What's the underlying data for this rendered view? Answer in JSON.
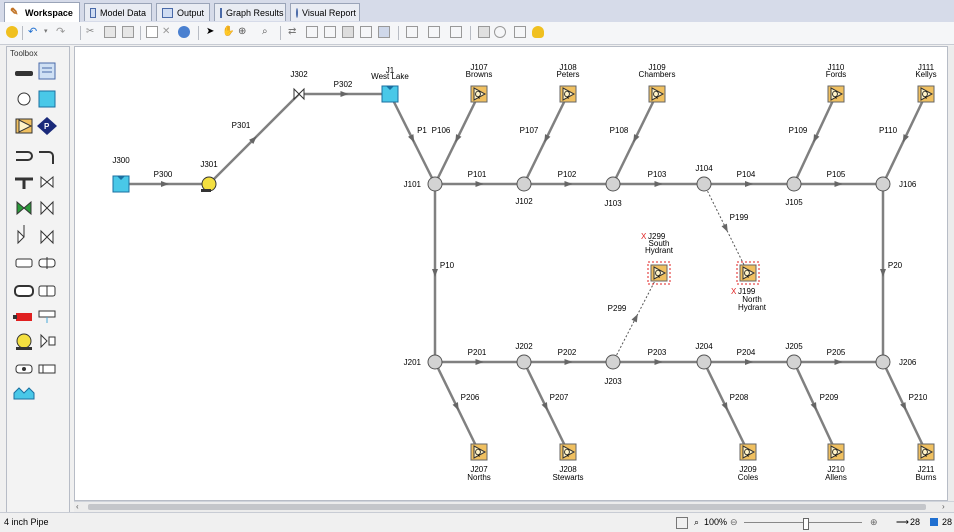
{
  "tabs": [
    {
      "label": "Workspace",
      "active": true
    },
    {
      "label": "Model Data",
      "active": false
    },
    {
      "label": "Output",
      "active": false
    },
    {
      "label": "Graph Results",
      "active": false
    },
    {
      "label": "Visual Report",
      "active": false
    }
  ],
  "toolbox": {
    "title": "Toolbox"
  },
  "canvas": {
    "pipes": [
      "P1",
      "P10",
      "P20",
      "P101",
      "P102",
      "P103",
      "P104",
      "P105",
      "P106",
      "P107",
      "P108",
      "P109",
      "P110",
      "P199",
      "P201",
      "P202",
      "P203",
      "P204",
      "P205",
      "P206",
      "P207",
      "P208",
      "P209",
      "P210",
      "P299",
      "P300",
      "P301",
      "P302"
    ],
    "junctions": [
      "J101",
      "J102",
      "J103",
      "J104",
      "J105",
      "J106",
      "J201",
      "J202",
      "J203",
      "J204",
      "J205",
      "J206"
    ],
    "assigned_flows": [
      {
        "id": "J107",
        "name": "Browns"
      },
      {
        "id": "J108",
        "name": "Peters"
      },
      {
        "id": "J109",
        "name": "Chambers"
      },
      {
        "id": "J110",
        "name": "Fords"
      },
      {
        "id": "J111",
        "name": "Kellys"
      },
      {
        "id": "J207",
        "name": "Norths"
      },
      {
        "id": "J208",
        "name": "Stewarts"
      },
      {
        "id": "J209",
        "name": "Coles"
      },
      {
        "id": "J210",
        "name": "Allens"
      },
      {
        "id": "J211",
        "name": "Burns"
      }
    ],
    "hydrants": [
      {
        "id": "J299",
        "name_line1": "South",
        "name_line2": "Hydrant",
        "marker": "X"
      },
      {
        "id": "J199",
        "name_line1": "North",
        "name_line2": "Hydrant",
        "marker": "X"
      }
    ],
    "reservoirs": [
      {
        "id": "J1",
        "name": "West Lake"
      },
      {
        "id": "J300",
        "name": ""
      }
    ],
    "pump": {
      "id": "J301"
    },
    "valve": {
      "id": "J302"
    }
  },
  "status": {
    "left_text": "4 inch Pipe",
    "zoom": "100%",
    "pipe_count": "28",
    "junction_count": "28"
  },
  "colors": {
    "pipe": "#808080",
    "node_fill": "#d3d3d3",
    "reservoir": "#49c8e8",
    "flow_junction": "#f0c060",
    "pump": "#f4e040",
    "closed_marker": "#e02020",
    "accent_blue": "#1f6fd0"
  }
}
